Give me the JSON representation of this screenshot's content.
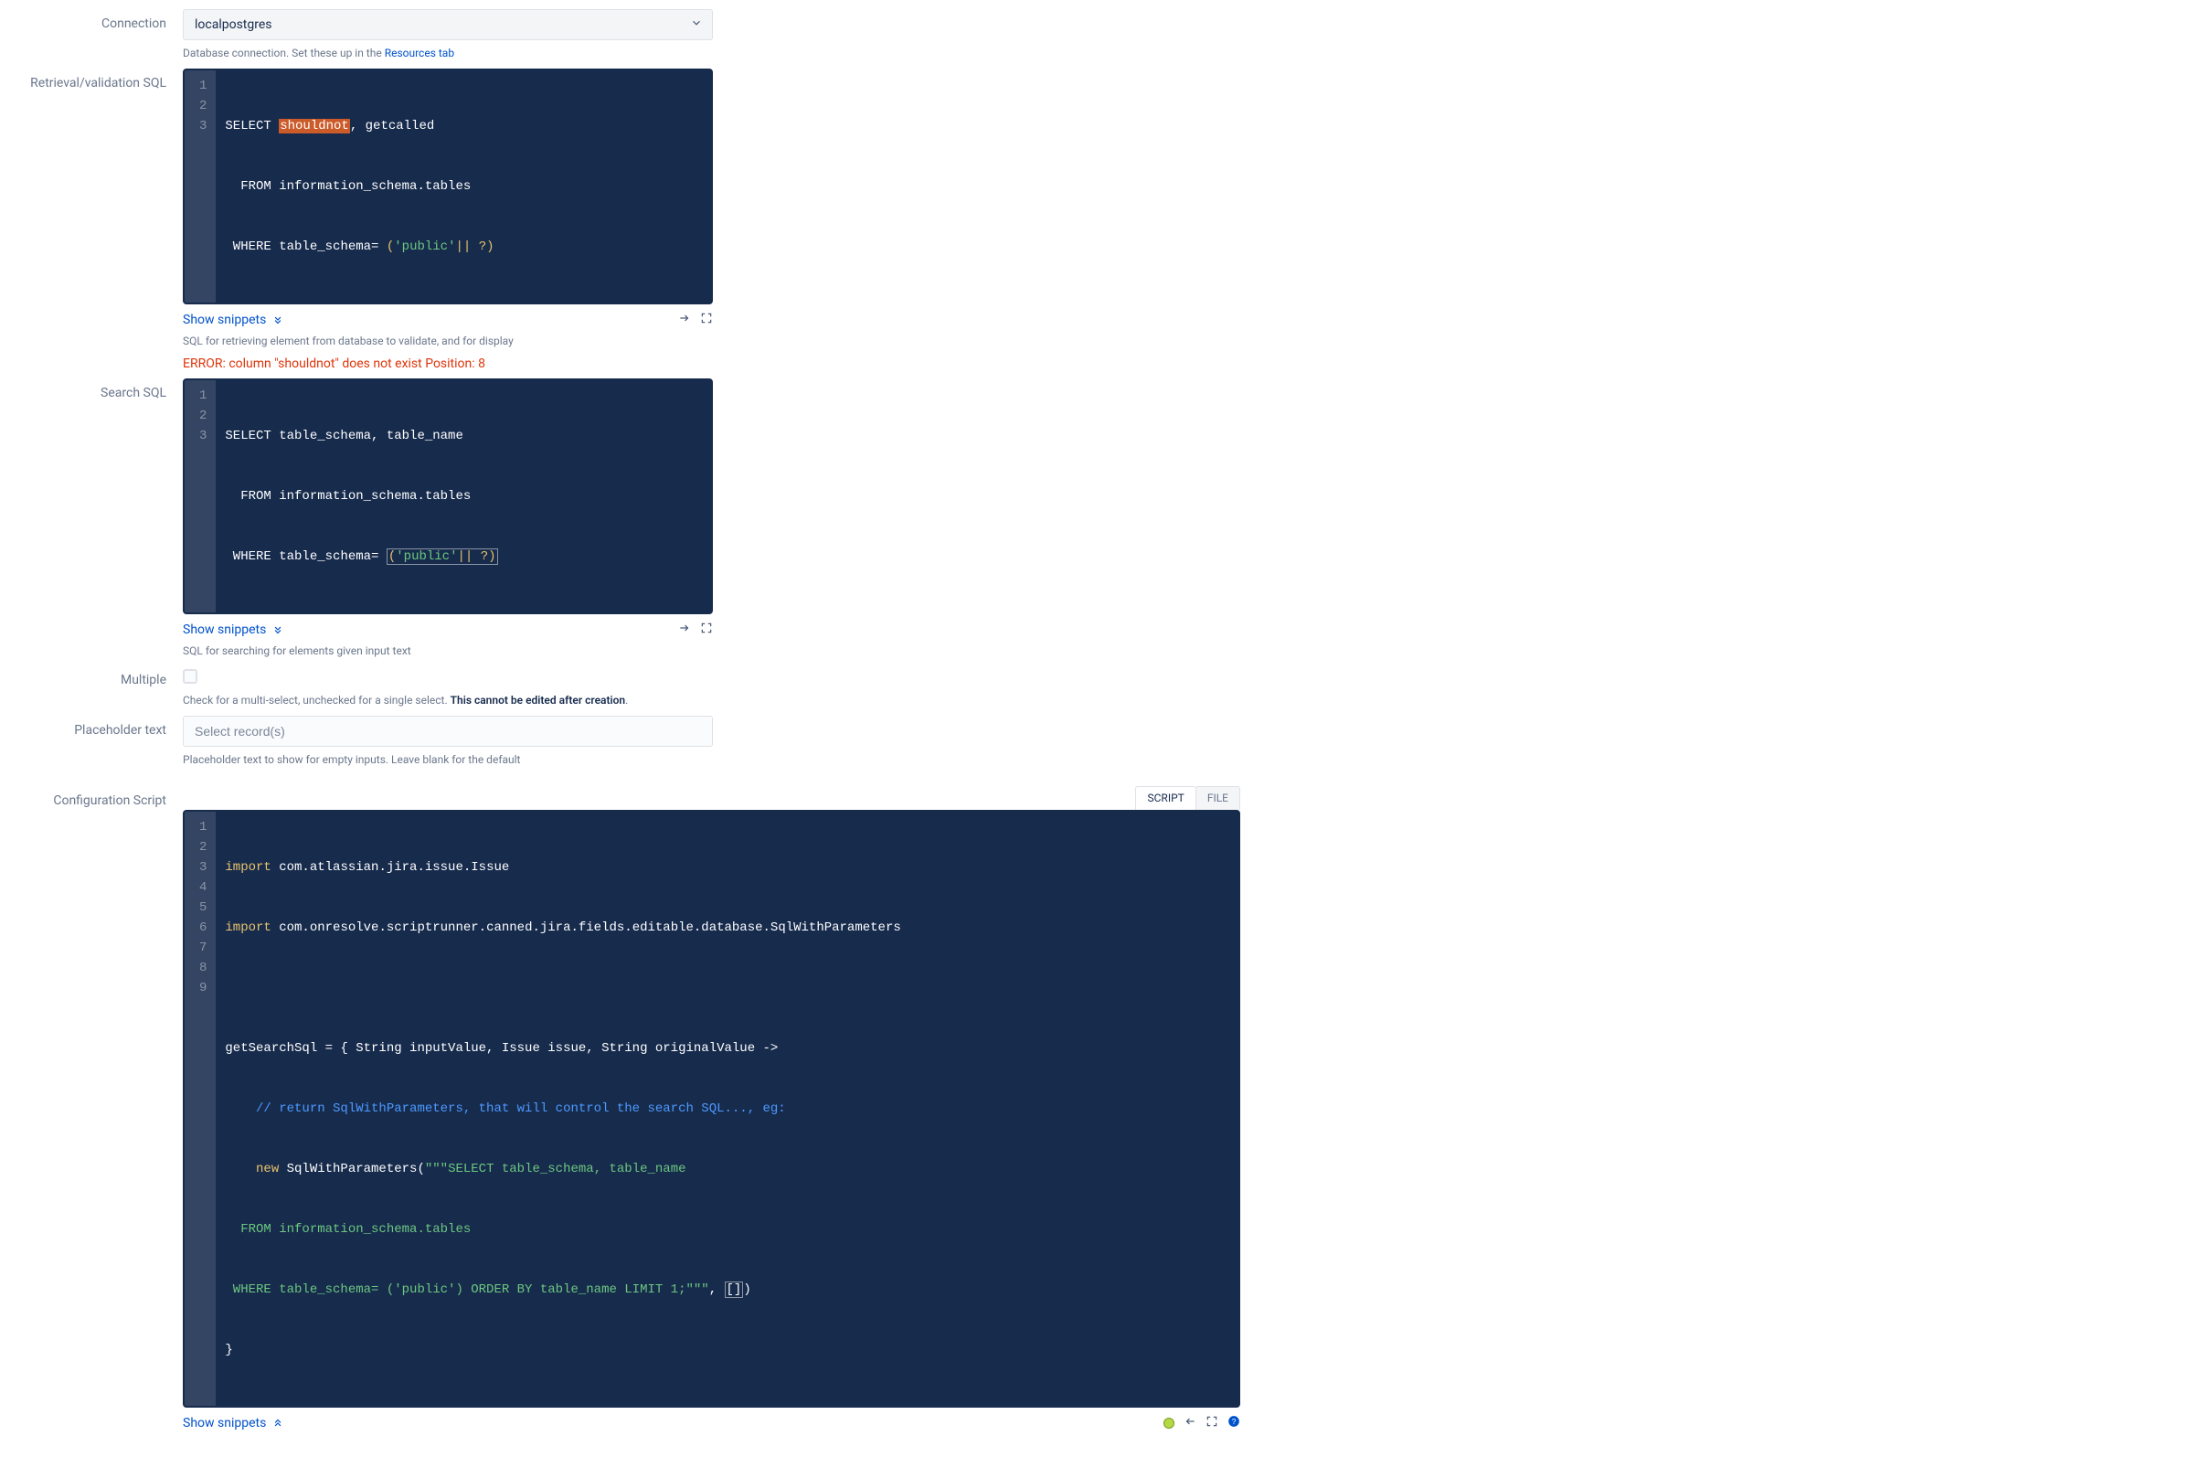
{
  "connection": {
    "label": "Connection",
    "value": "localpostgres",
    "hint_prefix": "Database connection. Set these up in the ",
    "hint_link": "Resources tab"
  },
  "retrieval": {
    "label": "Retrieval/validation SQL",
    "code": {
      "lines": [
        "1",
        "2",
        "3"
      ],
      "l1_a": "SELECT ",
      "l1_hl": "shouldnot",
      "l1_b": ", getcalled",
      "l2_a": "  FROM",
      "l2_b": " information_schema.tables",
      "l3_a": " WHERE",
      "l3_b": " table_schema= ",
      "l3_p1": "(",
      "l3_str": "'public'",
      "l3_p2": "|| ?)"
    },
    "snippets": "Show snippets",
    "hint": "SQL for retrieving element from database to validate, and for display",
    "error": "ERROR: column \"shouldnot\" does not exist Position: 8"
  },
  "search": {
    "label": "Search SQL",
    "code": {
      "lines": [
        "1",
        "2",
        "3"
      ],
      "l1": "SELECT table_schema, table_name",
      "l2_a": "  FROM",
      "l2_b": " information_schema.tables",
      "l3_a": " WHERE",
      "l3_b": " table_schema= ",
      "l3_p1": "(",
      "l3_str": "'public'",
      "l3_p2": "|| ?)"
    },
    "snippets": "Show snippets",
    "hint": "SQL for searching for elements given input text"
  },
  "multiple": {
    "label": "Multiple",
    "hint_a": "Check for a multi-select, unchecked for a single select. ",
    "hint_b": "This cannot be edited after creation",
    "hint_c": "."
  },
  "placeholder_field": {
    "label": "Placeholder text",
    "placeholder": "Select record(s)",
    "hint": "Placeholder text to show for empty inputs. Leave blank for the default"
  },
  "config": {
    "label": "Configuration Script",
    "tabs": {
      "script": "SCRIPT",
      "file": "FILE"
    },
    "code": {
      "lines": [
        "1",
        "2",
        "3",
        "4",
        "5",
        "6",
        "7",
        "8",
        "9"
      ],
      "l1_a": "import",
      "l1_b": " com.atlassian.jira.issue.Issue",
      "l2_a": "import",
      "l2_b": " com.onresolve.scriptrunner.canned.jira.fields.editable.database.SqlWithParameters",
      "l3": "",
      "l4": "getSearchSql = { String inputValue, Issue issue, String originalValue ->",
      "l5_com": "    // return SqlWithParameters, that will control the search SQL..., eg:",
      "l6_a": "    new",
      "l6_b": " SqlWithParameters(",
      "l6_str": "\"\"\"SELECT table_schema, table_name",
      "l7_str": "  FROM information_schema.tables",
      "l8_str": " WHERE table_schema= ('public') ORDER BY table_name LIMIT 1;\"\"\"",
      "l8_b": ", ",
      "l8_brk": "[]",
      "l8_c": ")",
      "l9": "}"
    },
    "snippets": "Show snippets"
  }
}
